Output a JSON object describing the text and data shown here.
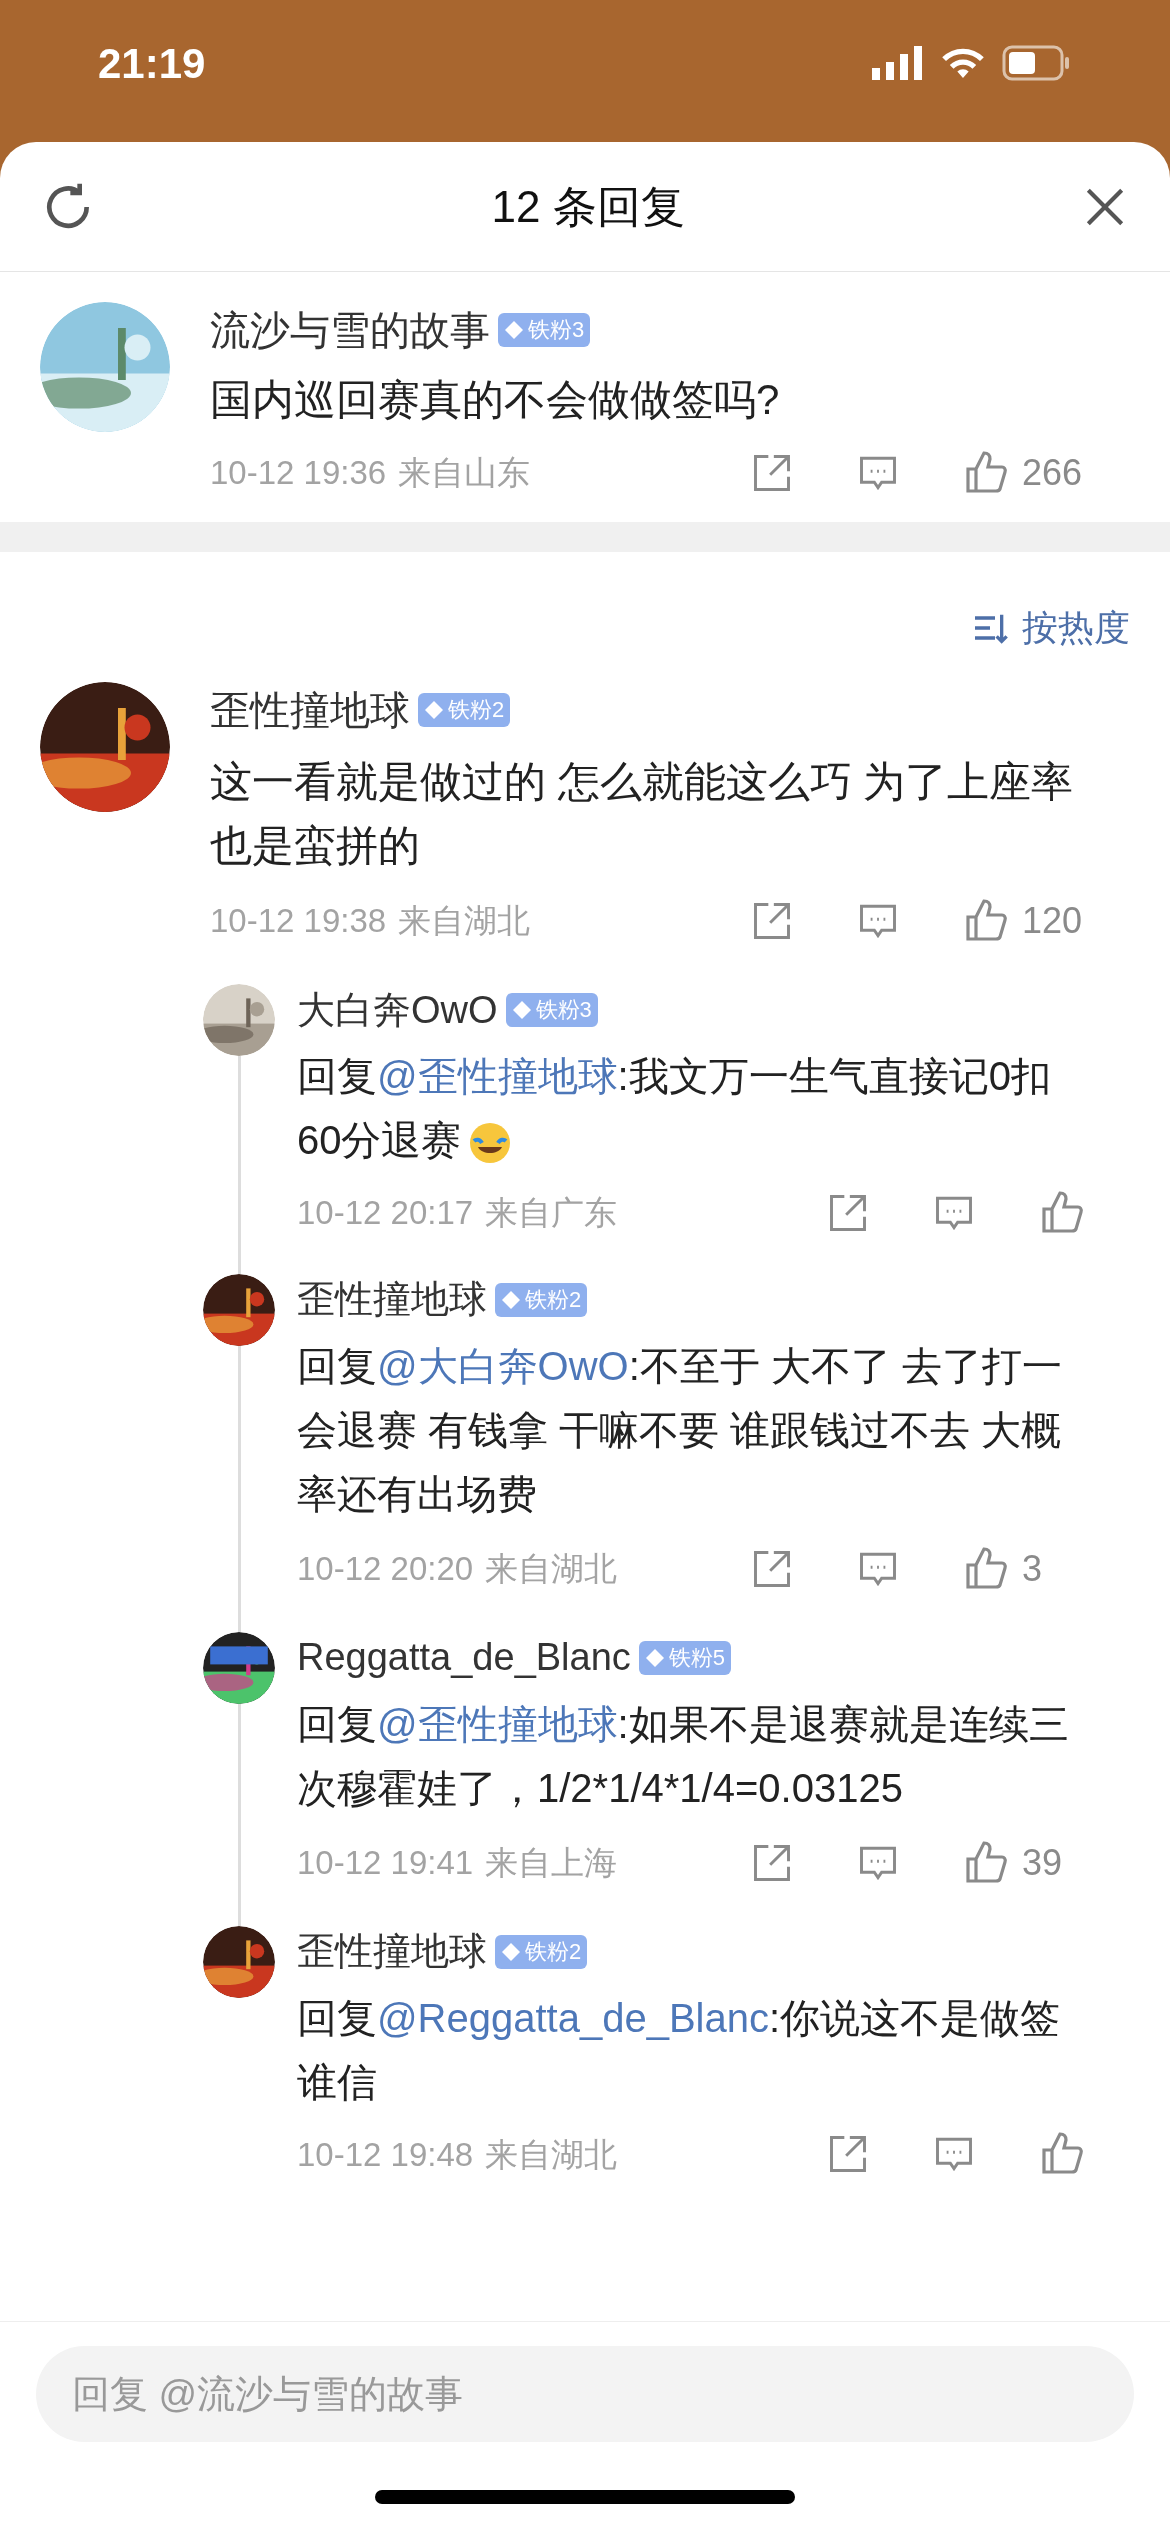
{
  "status_bar": {
    "time": "21:19"
  },
  "header": {
    "title": "12 条回复"
  },
  "root_comment": {
    "user": "流沙与雪的故事",
    "badge": "铁粉3",
    "text": "国内巡回赛真的不会做做签吗?",
    "date": "10-12 19:36",
    "location": "来自山东",
    "likes": "266"
  },
  "sort": {
    "label": "按热度"
  },
  "comments": [
    {
      "user": "歪性撞地球",
      "badge": "铁粉2",
      "text": "这一看就是做过的 怎么就能这么巧 为了上座率也是蛮拼的",
      "date": "10-12 19:38",
      "location": "来自湖北",
      "likes": "120",
      "replies": [
        {
          "user": "大白奔OwO",
          "badge": "铁粉3",
          "prefix": "回复",
          "mention": "@歪性撞地球",
          "text": ":我文万一生气直接记0扣60分退赛",
          "emoji": true,
          "date": "10-12 20:17",
          "location": "来自广东"
        },
        {
          "user": "歪性撞地球",
          "badge": "铁粉2",
          "prefix": "回复",
          "mention": "@大白奔OwO",
          "text": ":不至于 大不了 去了打一会退赛 有钱拿 干嘛不要 谁跟钱过不去 大概率还有出场费",
          "emoji": false,
          "date": "10-12 20:20",
          "location": "来自湖北",
          "likes": "3"
        },
        {
          "user": "Reggatta_de_Blanc",
          "badge": "铁粉5",
          "prefix": "回复",
          "mention": "@歪性撞地球",
          "text": ":如果不是退赛就是连续三次穆霍娃了，1/2*1/4*1/4=0.03125",
          "emoji": false,
          "date": "10-12 19:41",
          "location": "来自上海",
          "likes": "39"
        },
        {
          "user": "歪性撞地球",
          "badge": "铁粉2",
          "prefix": "回复",
          "mention": "@Reggatta_de_Blanc",
          "text": ":你说这不是做签谁信",
          "emoji": false,
          "date": "10-12 19:48",
          "location": "来自湖北"
        }
      ]
    }
  ],
  "reply_box": {
    "placeholder": "回复 @流沙与雪的故事"
  }
}
